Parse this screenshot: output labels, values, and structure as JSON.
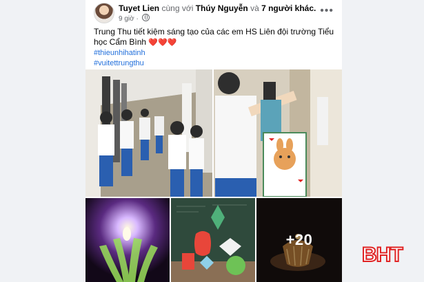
{
  "post": {
    "author_name": "Tuyet Lien",
    "with_text": "cùng với",
    "tagged_name": "Thúy Nguyễn",
    "and_text": "và",
    "others_text": "7 người khác.",
    "time": "9 giờ",
    "more_icon": "ellipsis-icon",
    "body": "Trung Thu tiết kiệm sáng tạo của các em HS Liên đội trường Tiểu học Cẩm Bình",
    "hearts": "❤️❤️❤️",
    "hashtags": [
      "#thieunhihatinh",
      "#vuitettrungthu"
    ],
    "more_photos_label": "+20"
  },
  "watermark": "BHT",
  "colors": {
    "hashtag": "#216fdb",
    "heart": "#e2233e",
    "watermark": "#e02424",
    "background": "#f0f2f5"
  }
}
